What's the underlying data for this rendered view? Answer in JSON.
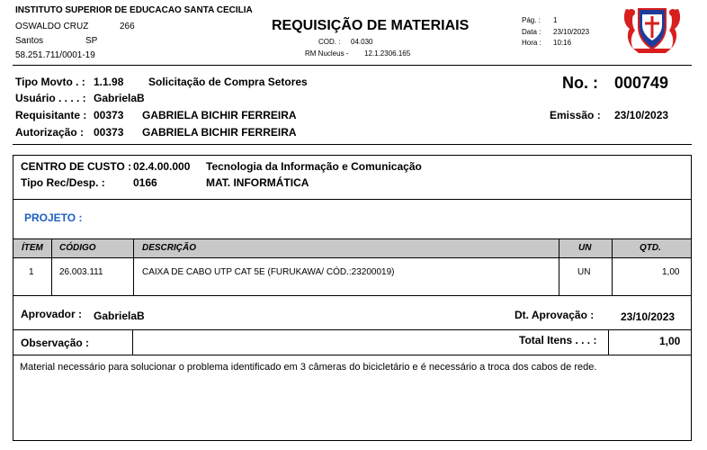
{
  "institution": {
    "name": "INSTITUTO SUPERIOR DE EDUCACAO SANTA CECILIA",
    "street": "OSWALDO CRUZ",
    "number": "266",
    "city": "Santos",
    "state": "SP",
    "cnpj": "58.251.711/0001-19"
  },
  "doc": {
    "title": "REQUISIÇÃO DE MATERIAIS",
    "cod_label": "COD. :",
    "cod_value": "04.030",
    "rm_label": "RM Nucleus  -",
    "rm_value": "12.1.2306.165"
  },
  "meta": {
    "page_label": "Pág. :",
    "page_value": "1",
    "date_label": "Data :",
    "date_value": "23/10/2023",
    "hour_label": "Hora :",
    "hour_value": "10:16"
  },
  "header_fields": {
    "tipo_label": "Tipo Movto  . :",
    "tipo_code": "1.1.98",
    "tipo_desc": "Solicitação de Compra Setores",
    "usuario_label": "Usuário . . . . :",
    "usuario_value": "GabrielaB",
    "requisitante_label": "Requisitante :",
    "requisitante_code": "00373",
    "requisitante_name": "GABRIELA BICHIR FERREIRA",
    "autorizacao_label": "Autorização  :",
    "autorizacao_code": "00373",
    "autorizacao_name": "GABRIELA BICHIR FERREIRA",
    "no_label": "No. :",
    "no_value": "000749",
    "emissao_label": "Emissão :",
    "emissao_value": "23/10/2023"
  },
  "cost_center": {
    "cc_label": "CENTRO DE CUSTO :",
    "cc_code": "02.4.00.000",
    "cc_desc": "Tecnologia da Informação e Comunicação",
    "tipo_label": "Tipo Rec/Desp. :",
    "tipo_code": "0166",
    "tipo_desc": "MAT. INFORMÁTICA",
    "projeto_label": "PROJETO :"
  },
  "table": {
    "headers": [
      "ÍTEM",
      "CÓDIGO",
      "DESCRIÇÃO",
      "UN",
      "QTD."
    ],
    "rows": [
      [
        "1",
        "26.003.111",
        "CAIXA DE CABO UTP CAT 5E (FURUKAWA/ CÓD.:23200019)",
        "UN",
        "1,00"
      ]
    ]
  },
  "footer": {
    "aprovador_label": "Aprovador :",
    "aprovador_value": "GabrielaB",
    "dt_label": "Dt. Aprovação :",
    "dt_value": "23/10/2023",
    "obs_label": "Observação :",
    "total_label": "Total Itens . . . :",
    "total_value": "1,00",
    "obs_text": "Material necessário para solucionar o problema identificado em 3 câmeras do bicicletário e é necessário a troca dos cabos de rede."
  },
  "colors": {
    "accent_blue": "#1f5fbf",
    "header_gray": "#c8c8c8",
    "logo_red": "#d81e1e",
    "logo_blue": "#1c3c9c"
  }
}
